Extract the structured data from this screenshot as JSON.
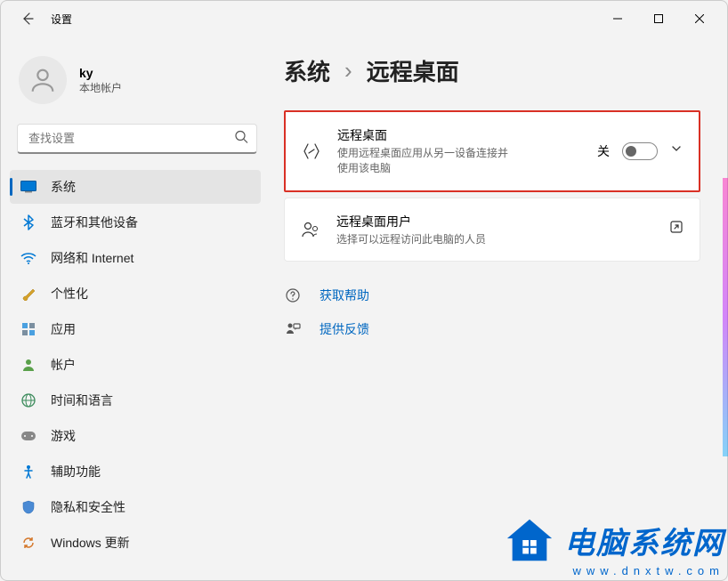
{
  "app_title": "设置",
  "profile": {
    "name": "ky",
    "sub": "本地帐户"
  },
  "search": {
    "placeholder": "查找设置"
  },
  "nav": {
    "items": [
      {
        "label": "系统"
      },
      {
        "label": "蓝牙和其他设备"
      },
      {
        "label": "网络和 Internet"
      },
      {
        "label": "个性化"
      },
      {
        "label": "应用"
      },
      {
        "label": "帐户"
      },
      {
        "label": "时间和语言"
      },
      {
        "label": "游戏"
      },
      {
        "label": "辅助功能"
      },
      {
        "label": "隐私和安全性"
      },
      {
        "label": "Windows 更新"
      }
    ]
  },
  "breadcrumb": {
    "root": "系统",
    "sep": "›",
    "page": "远程桌面"
  },
  "cards": {
    "remote": {
      "title": "远程桌面",
      "sub": "使用远程桌面应用从另一设备连接并使用该电脑",
      "toggle_label": "关"
    },
    "users": {
      "title": "远程桌面用户",
      "sub": "选择可以远程访问此电脑的人员"
    }
  },
  "links": {
    "help": "获取帮助",
    "feedback": "提供反馈"
  },
  "watermark": {
    "main": "电脑系统网",
    "sub": "www.dnxtw.com"
  }
}
